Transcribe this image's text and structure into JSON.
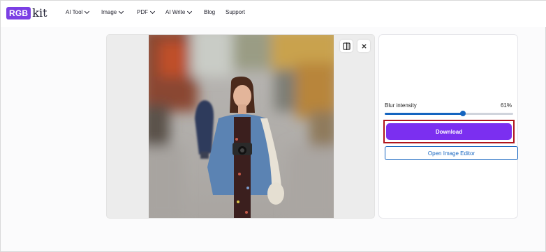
{
  "logo": {
    "badge": "RGB",
    "suffix": "kit"
  },
  "nav": [
    {
      "label": "AI Tool",
      "dropdown": true
    },
    {
      "label": "Image",
      "dropdown": true
    },
    {
      "label": "PDF",
      "dropdown": true
    },
    {
      "label": "AI Write",
      "dropdown": true
    },
    {
      "label": "Blog",
      "dropdown": false
    },
    {
      "label": "Support",
      "dropdown": false
    }
  ],
  "toolbar": {
    "compare_icon": "compare-split-icon",
    "close_icon": "close-icon"
  },
  "panel": {
    "blur_label": "Blur intensity",
    "blur_value": "61%",
    "blur_fraction": 0.61,
    "download_label": "Download",
    "editor_label": "Open Image Editor"
  },
  "colors": {
    "brand": "#7b3fe4",
    "download": "#7b2ff0",
    "accent": "#1565c0",
    "highlight": "#b0141c"
  }
}
